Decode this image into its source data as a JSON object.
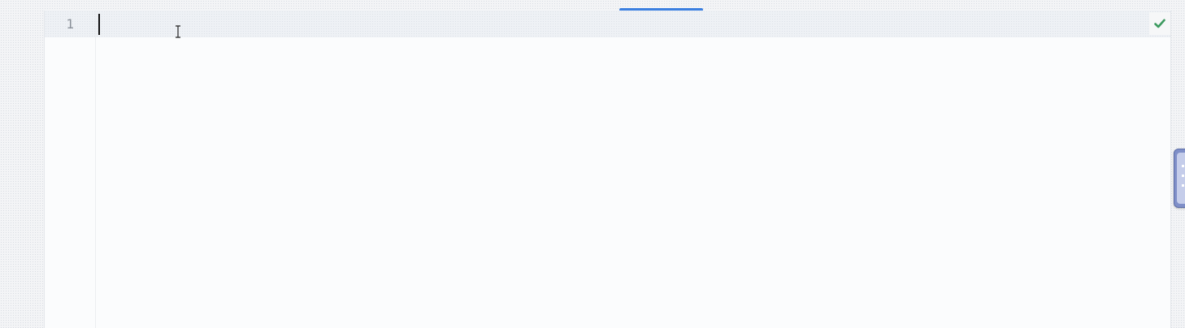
{
  "editor": {
    "lines": [
      {
        "number": "1",
        "text": ""
      }
    ]
  },
  "status": {
    "validation_icon": "checkmark-icon",
    "validation_color": "#3c9a5f"
  },
  "theme": {
    "accent": "#3b7fe0",
    "side_tab_color": "#7f8fc8"
  }
}
